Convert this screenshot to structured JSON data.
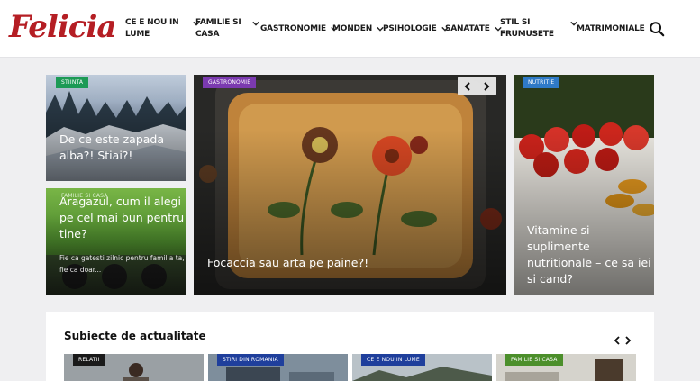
{
  "brand": {
    "logo_text": "Felicia",
    "color": "#b51e24"
  },
  "nav": {
    "items": [
      {
        "label_line1": "CE E NOU IN",
        "label_line2": "LUME",
        "has_dropdown": true
      },
      {
        "label_line1": "FAMILIE SI",
        "label_line2": "CASA",
        "has_dropdown": true
      },
      {
        "label_line1": "GASTRONOMIE",
        "label_line2": "",
        "has_dropdown": true
      },
      {
        "label_line1": "MONDEN",
        "label_line2": "",
        "has_dropdown": true
      },
      {
        "label_line1": "PSIHOLOGIE",
        "label_line2": "",
        "has_dropdown": true
      },
      {
        "label_line1": "SANATATE",
        "label_line2": "",
        "has_dropdown": true
      },
      {
        "label_line1": "STIL SI",
        "label_line2": "FRUMUSETE",
        "has_dropdown": true
      },
      {
        "label_line1": "MATRIMONIALE",
        "label_line2": "",
        "has_dropdown": false
      }
    ],
    "search_icon": "search-icon"
  },
  "featured": {
    "card_snow": {
      "badge": "STIINTA",
      "badge_color": "#1c9a55",
      "title_line1": "De ce este zapada",
      "title_line2": "alba?! Stiai?!"
    },
    "card_gas": {
      "badge": "FAMILIE SI CASA",
      "badge_color": "#4c8f2b",
      "title_line1": "Aragazul, cum il alegi",
      "title_line2": "pe cel mai bun pentru",
      "title_line3": "tine?",
      "excerpt_line1": "Fie ca gatesti zilnic pentru familia ta,",
      "excerpt_line2": "fie ca doar..."
    },
    "card_focaccia": {
      "badge": "GASTRONOMIE",
      "badge_color": "#7b3ab0",
      "title": "Focaccia sau arta pe paine?!"
    },
    "card_vitamins": {
      "badge": "NUTRITIE",
      "badge_color": "#2f7ac7",
      "title_line1": "Vitamine si suplimente",
      "title_line2": "nutritionale – ce sa iei",
      "title_line3": "si cand?"
    }
  },
  "topics": {
    "title": "Subiecte de actualitate",
    "items": [
      {
        "badge": "RELATII",
        "badge_color": "#1a1a1a"
      },
      {
        "badge": "STIRI DIN ROMANIA",
        "badge_color": "#1f3f9c"
      },
      {
        "badge": "CE E NOU IN LUME",
        "badge_color": "#1f3f9c"
      },
      {
        "badge": "FAMILIE SI CASA",
        "badge_color": "#4c8f2b"
      }
    ]
  }
}
